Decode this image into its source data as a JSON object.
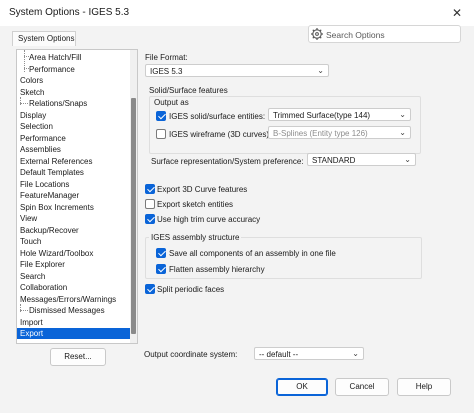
{
  "window": {
    "title": "System Options - IGES 5.3",
    "close_glyph": "✕"
  },
  "tab": {
    "label": "System Options"
  },
  "search": {
    "placeholder": "Search Options"
  },
  "tree": {
    "items": [
      {
        "label": "Area Hatch/Fill",
        "indent": 2
      },
      {
        "label": "Performance",
        "indent": 2
      },
      {
        "label": "Colors",
        "indent": 0
      },
      {
        "label": "Sketch",
        "indent": 0
      },
      {
        "label": "Relations/Snaps",
        "indent": 1
      },
      {
        "label": "Display",
        "indent": 0
      },
      {
        "label": "Selection",
        "indent": 0
      },
      {
        "label": "Performance",
        "indent": 0
      },
      {
        "label": "Assemblies",
        "indent": 0
      },
      {
        "label": "External References",
        "indent": 0
      },
      {
        "label": "Default Templates",
        "indent": 0
      },
      {
        "label": "File Locations",
        "indent": 0
      },
      {
        "label": "FeatureManager",
        "indent": 0
      },
      {
        "label": "Spin Box Increments",
        "indent": 0
      },
      {
        "label": "View",
        "indent": 0
      },
      {
        "label": "Backup/Recover",
        "indent": 0
      },
      {
        "label": "Touch",
        "indent": 0
      },
      {
        "label": "Hole Wizard/Toolbox",
        "indent": 0
      },
      {
        "label": "File Explorer",
        "indent": 0
      },
      {
        "label": "Search",
        "indent": 0
      },
      {
        "label": "Collaboration",
        "indent": 0
      },
      {
        "label": "Messages/Errors/Warnings",
        "indent": 0
      },
      {
        "label": "Dismissed Messages",
        "indent": 1
      },
      {
        "label": "Import",
        "indent": 0
      },
      {
        "label": "Export",
        "indent": 0,
        "selected": true
      }
    ],
    "reset_label": "Reset..."
  },
  "export": {
    "file_format_label": "File Format:",
    "file_format_value": "IGES 5.3",
    "solid_surface_label": "Solid/Surface features",
    "output_as_label": "Output as",
    "solid_entities": {
      "label": "IGES solid/surface entities:",
      "checked": true,
      "value": "Trimmed Surface(type 144)"
    },
    "wireframe": {
      "label": "IGES wireframe (3D curves):",
      "checked": false,
      "value": "B-Splines (Entity type 126)"
    },
    "surface_rep_label": "Surface representation/System preference:",
    "surface_rep_value": "STANDARD",
    "export_3d_curve": {
      "label": "Export 3D Curve features",
      "checked": true
    },
    "export_sketch": {
      "label": "Export sketch entities",
      "checked": false
    },
    "high_trim": {
      "label": "Use high trim curve accuracy",
      "checked": true
    },
    "assembly_structure_label": "IGES assembly structure",
    "save_all_components": {
      "label": "Save all components of an assembly in one file",
      "checked": true
    },
    "flatten_hierarchy": {
      "label": "Flatten assembly hierarchy",
      "checked": true
    },
    "split_periodic": {
      "label": "Split periodic faces",
      "checked": true
    },
    "output_coord_label": "Output coordinate system:",
    "output_coord_value": "-- default --"
  },
  "buttons": {
    "ok": "OK",
    "cancel": "Cancel",
    "help": "Help"
  },
  "colors": {
    "accent": "#0a64d8",
    "selection_text": "#ffffff",
    "dialog_bg": "#f3f3f3"
  },
  "icons": {
    "search": "search-icon",
    "close": "close-icon",
    "dropdown": "chevron-down-icon"
  }
}
